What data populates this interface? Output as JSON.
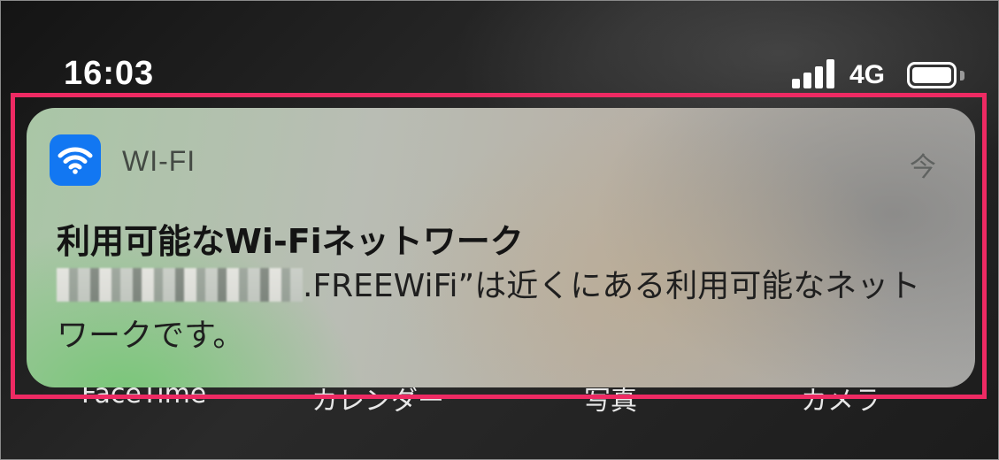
{
  "status_bar": {
    "time": "16:03",
    "network": "4G",
    "signal_icon": "cellular-signal-icon",
    "battery_icon": "battery-icon"
  },
  "background_apps": {
    "app_1": "FaceTime",
    "app_2": "カレンダー",
    "app_3": "写真",
    "app_4": "カメラ"
  },
  "notification": {
    "app_icon": "wifi-icon",
    "app_name": "WI-FI",
    "timestamp": "今",
    "title": "利用可能なWi-Fiネットワーク",
    "body_after_redaction": ".FREEWiFi”は近くにある利用可能なネットワークです。"
  },
  "colors": {
    "highlight": "#ee2a63",
    "wifi_icon_bg": "#1277f2"
  }
}
